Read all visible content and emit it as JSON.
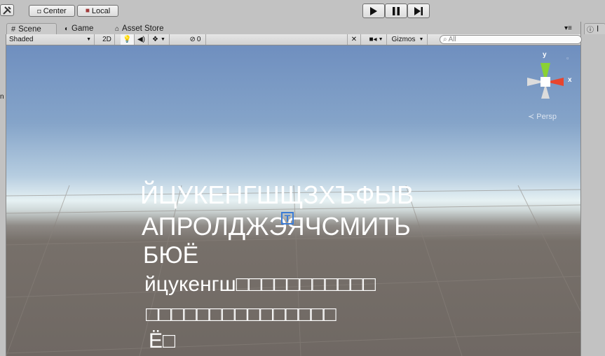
{
  "toolbar": {
    "pivot_label": "Center",
    "space_label": "Local"
  },
  "tabs": [
    {
      "label": "Scene"
    },
    {
      "label": "Game"
    },
    {
      "label": "Asset Store"
    }
  ],
  "right_tab": {
    "label": "I"
  },
  "scene_toolbar": {
    "draw_mode": "Shaded",
    "mode_2d": "2D",
    "hidden_count": "0",
    "gizmos_label": "Gizmos",
    "search_placeholder": "All"
  },
  "gizmo": {
    "y_label": "y",
    "x_label": "x",
    "persp_label": "Persp"
  },
  "scene_text": {
    "line1": "ЙЦУКЕНГШЩЗХЪФЫВ",
    "line2": "АПРОЛДЖЭЯЧСМИТЬ",
    "line3": "БЮЁ",
    "line4": "йцукенгш□□□□□□□□□□□",
    "line5": "□□□□□□□□□□□□□□□",
    "line6": "Ё□"
  },
  "colors": {
    "accent": "#3a7bd5",
    "x_axis": "#e8452e",
    "y_axis": "#8ad134"
  }
}
